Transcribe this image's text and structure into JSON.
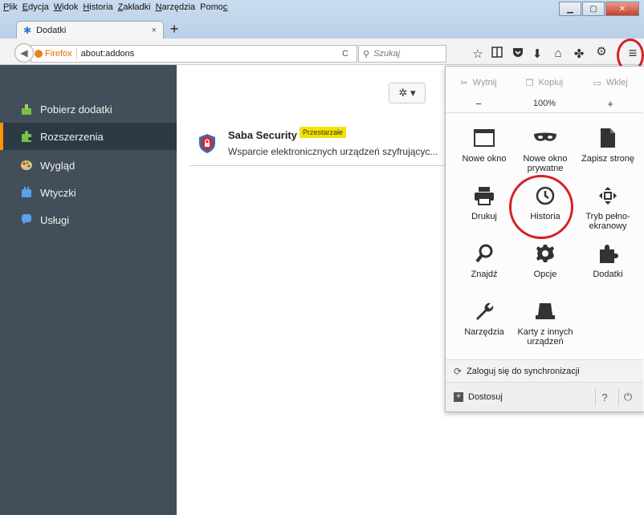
{
  "menubar": {
    "items": [
      {
        "pre": "",
        "acc": "P",
        "post": "lik"
      },
      {
        "pre": "",
        "acc": "E",
        "post": "dycja"
      },
      {
        "pre": "",
        "acc": "W",
        "post": "idok"
      },
      {
        "pre": "",
        "acc": "H",
        "post": "istoria"
      },
      {
        "pre": "",
        "acc": "Z",
        "post": "akładki"
      },
      {
        "pre": "",
        "acc": "N",
        "post": "arzędzia"
      },
      {
        "pre": "Pomo",
        "acc": "c",
        "post": ""
      }
    ]
  },
  "tab": {
    "title": "Dodatki",
    "close": "×"
  },
  "newtab": "+",
  "urlbar": {
    "brand": "Firefox",
    "url": "about:addons",
    "reload": "C"
  },
  "search": {
    "placeholder": "Szukaj"
  },
  "sidebar": {
    "items": [
      {
        "label": "Pobierz dodatki",
        "icon": "get-addons-icon"
      },
      {
        "label": "Rozszerzenia",
        "icon": "extensions-icon",
        "selected": true
      },
      {
        "label": "Wygląd",
        "icon": "appearance-icon"
      },
      {
        "label": "Wtyczki",
        "icon": "plugins-icon"
      },
      {
        "label": "Usługi",
        "icon": "services-icon"
      }
    ]
  },
  "addon": {
    "name": "Saba Security",
    "badge": "Przestarzałe",
    "description": "Wsparcie elektronicznych urządzeń szyfrującyc..."
  },
  "panel": {
    "edit": {
      "cut": "Wytnij",
      "copy": "Kopiuj",
      "paste": "Wklej"
    },
    "zoom": {
      "minus": "−",
      "value": "100%",
      "plus": "+"
    },
    "items": {
      "new_window": "Nowe okno",
      "private_window_1": "Nowe okno",
      "private_window_2": "prywatne",
      "save_page": "Zapisz stronę",
      "print": "Drukuj",
      "history": "Historia",
      "fullscreen_1": "Tryb pełno-",
      "fullscreen_2": "ekranowy",
      "find": "Znajdź",
      "options": "Opcje",
      "addons": "Dodatki",
      "developer": "Narzędzia",
      "synced_tabs_1": "Karty z innych",
      "synced_tabs_2": "urządzeń"
    },
    "sync": "Zaloguj się do synchronizacji",
    "customize": "Dostosuj"
  },
  "colors": {
    "accent": "#ff9500",
    "annotation": "#d61f26",
    "sidebar_bg": "#424f5a",
    "badge": "#f5e300"
  }
}
